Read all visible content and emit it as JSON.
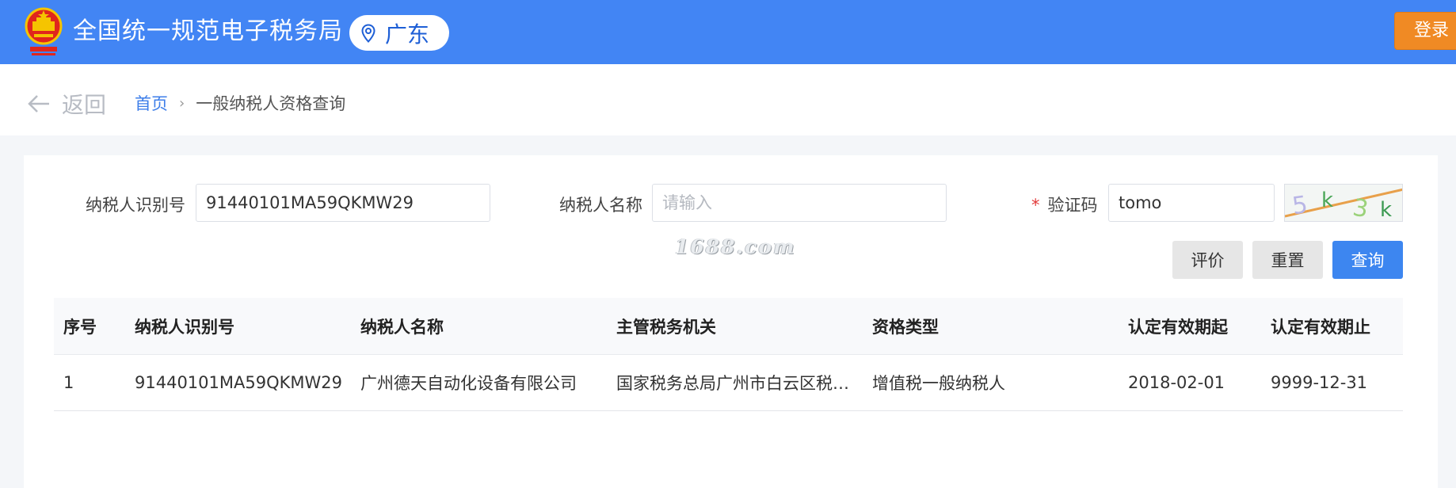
{
  "header": {
    "title": "全国统一规范电子税务局",
    "region": "广东",
    "login_label": "登录",
    "colors": {
      "bar": "#4285f4",
      "login": "#f08a24"
    }
  },
  "breadcrumb": {
    "back_label": "返回",
    "home": "首页",
    "current": "一般纳税人资格查询"
  },
  "form": {
    "taxpayer_id": {
      "label": "纳税人识别号",
      "value": "91440101MA59QKMW29"
    },
    "taxpayer_name": {
      "label": "纳税人名称",
      "value": "",
      "placeholder": "请输入"
    },
    "captcha": {
      "required_mark": "*",
      "label": "验证码",
      "value": "tomo"
    }
  },
  "watermark": "1688.com",
  "buttons": {
    "evaluate": "评价",
    "reset": "重置",
    "query": "查询"
  },
  "table": {
    "columns": [
      "序号",
      "纳税人识别号",
      "纳税人名称",
      "主管税务机关",
      "资格类型",
      "认定有效期起",
      "认定有效期止"
    ],
    "rows": [
      [
        "1",
        "91440101MA59QKMW29",
        "广州德天自动化设备有限公司",
        "国家税务总局广州市白云区税…",
        "增值税一般纳税人",
        "2018-02-01",
        "9999-12-31"
      ]
    ]
  }
}
